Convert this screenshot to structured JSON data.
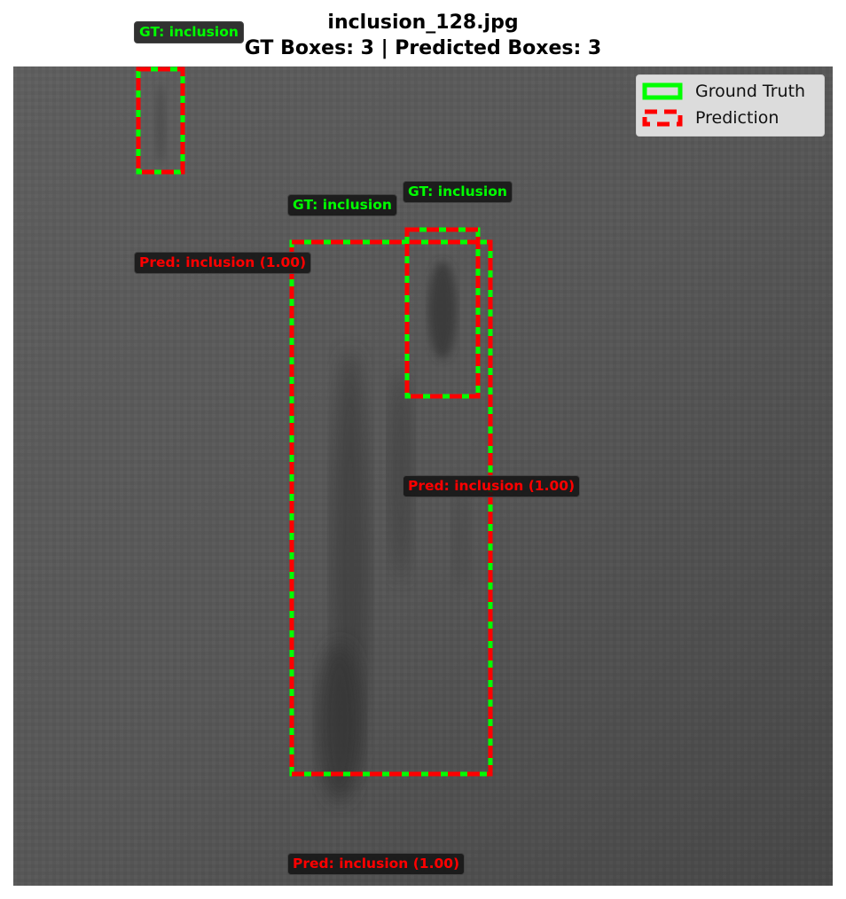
{
  "header": {
    "filename": "inclusion_128.jpg",
    "summary": "GT Boxes: 3 | Predicted Boxes: 3"
  },
  "legend": {
    "gt_label": "Ground Truth",
    "pred_label": "Prediction"
  },
  "labels": {
    "gt_1": "GT: inclusion",
    "gt_2": "GT: inclusion",
    "gt_3": "GT: inclusion",
    "pred_1": "Pred: inclusion (1.00)",
    "pred_2": "Pred: inclusion (1.00)",
    "pred_3": "Pred: inclusion (1.00)"
  },
  "colors": {
    "ground_truth": "#00ff00",
    "prediction": "#ff0000",
    "label_background": "#1a1a1a"
  }
}
